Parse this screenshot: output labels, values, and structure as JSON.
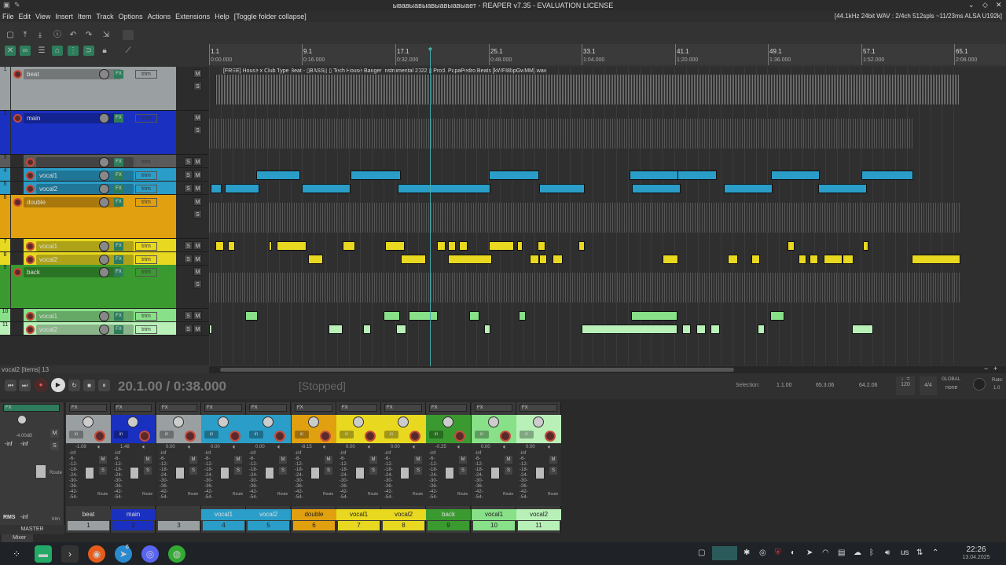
{
  "window": {
    "title": "ывавыавыавыавыавыает - REAPER v7.35 - EVALUATION LICENSE"
  },
  "menu": [
    "File",
    "Edit",
    "View",
    "Insert",
    "Item",
    "Track",
    "Options",
    "Actions",
    "Extensions",
    "Help",
    "[Toggle folder collapse]"
  ],
  "status_right": "[44.1kHz 24bit WAV : 2/4ch 512spls ~11/23ms ALSA U192k]",
  "ruler": [
    {
      "bar": "1.1",
      "time": "0:00.000"
    },
    {
      "bar": "9.1",
      "time": "0:16.000"
    },
    {
      "bar": "17.1",
      "time": "0:32.000"
    },
    {
      "bar": "25.1",
      "time": "0:48.000"
    },
    {
      "bar": "33.1",
      "time": "1:04.000"
    },
    {
      "bar": "41.1",
      "time": "1:20.000"
    },
    {
      "bar": "49.1",
      "time": "1:36.000"
    },
    {
      "bar": "57.1",
      "time": "1:52.000"
    },
    {
      "bar": "65.1",
      "time": "2:08.000"
    }
  ],
  "item_label": "[FREE] House x Club Type Beat - ▯BASS▯ ▯ Tech House Banger Instrumental 2022 ▯ Prod. PapaPedro Beats [kWFI8bpGwMM].wav",
  "tracks": [
    {
      "num": "1",
      "name": "beat",
      "color": "#9a9fa1"
    },
    {
      "num": "2",
      "name": "main",
      "color": "#1a30c0"
    },
    {
      "num": "3",
      "name": "",
      "color": "#5a5a5a"
    },
    {
      "num": "4",
      "name": "vocal1",
      "color": "#2a9ec8"
    },
    {
      "num": "5",
      "name": "vocal2",
      "color": "#2a9ec8"
    },
    {
      "num": "6",
      "name": "double",
      "color": "#e0a010"
    },
    {
      "num": "7",
      "name": "vocal1",
      "color": "#e8d820"
    },
    {
      "num": "8",
      "name": "vocal2",
      "color": "#e8d820"
    },
    {
      "num": "9",
      "name": "back",
      "color": "#3a9a30"
    },
    {
      "num": "10",
      "name": "vocal1",
      "color": "#88e088"
    },
    {
      "num": "11",
      "name": "vocal2",
      "color": "#b8f0b8"
    }
  ],
  "track_buttons": {
    "fx": "FX",
    "trim": "trim",
    "mute": "M",
    "solo": "S"
  },
  "transport": {
    "time": "20.1.00 / 0:38.000",
    "state": "[Stopped]",
    "selection_label": "Selection:",
    "sel_start": "1.1.00",
    "sel_end": "65.3.06",
    "sel_len": "64.2.06",
    "bpm": "120",
    "sig": "4/4",
    "global": "GLOBAL",
    "global_val": "none",
    "rate_label": "Rate:",
    "rate": "1.0"
  },
  "status_line": "vocal2 [items] 13",
  "mixer": {
    "master": {
      "label": "MASTER",
      "peak": "-4.00dB",
      "l": "-inf",
      "r": "-inf",
      "rms": "RMS",
      "rms_val": "-inf",
      "route": "Route",
      "trim": "trim"
    },
    "strips": [
      {
        "name": "beat",
        "num": "1",
        "vol": "-1.08",
        "color": "#9a9fa1",
        "namecolor": "#ddd"
      },
      {
        "name": "main",
        "num": "2",
        "vol": "1.48",
        "color": "#1a30c0",
        "namecolor": "#ddd"
      },
      {
        "name": "",
        "num": "3",
        "vol": "0.00",
        "color": "#9a9fa1",
        "namecolor": "#ddd"
      },
      {
        "name": "vocal1",
        "num": "4",
        "vol": "0.00",
        "color": "#2a9ec8",
        "namecolor": "#ddd"
      },
      {
        "name": "vocal2",
        "num": "5",
        "vol": "0.00",
        "color": "#2a9ec8",
        "namecolor": "#ddd"
      },
      {
        "name": "double",
        "num": "6",
        "vol": "-8.15",
        "color": "#e0a010",
        "namecolor": "#222"
      },
      {
        "name": "vocal1",
        "num": "7",
        "vol": "0.00",
        "color": "#e8d820",
        "namecolor": "#222"
      },
      {
        "name": "vocal2",
        "num": "8",
        "vol": "0.00",
        "color": "#e8d820",
        "namecolor": "#222"
      },
      {
        "name": "back",
        "num": "9",
        "vol": "-0.25",
        "color": "#3a9a30",
        "namecolor": "#ddd"
      },
      {
        "name": "vocal1",
        "num": "10",
        "vol": "0.00",
        "color": "#88e088",
        "namecolor": "#222"
      },
      {
        "name": "vocal2",
        "num": "11",
        "vol": "0.00",
        "color": "#b8f0b8",
        "namecolor": "#222"
      }
    ],
    "scale": [
      "-inf",
      "-6-",
      "-12-",
      "-18-",
      "-24-",
      "-30-",
      "-36-",
      "-42-",
      "-54-"
    ],
    "route": "Route",
    "in": "in"
  },
  "mixer_tab": "Mixer",
  "taskbar": {
    "lang": "us",
    "time": "22:26",
    "date": "13.04.2025",
    "badge": "6"
  }
}
